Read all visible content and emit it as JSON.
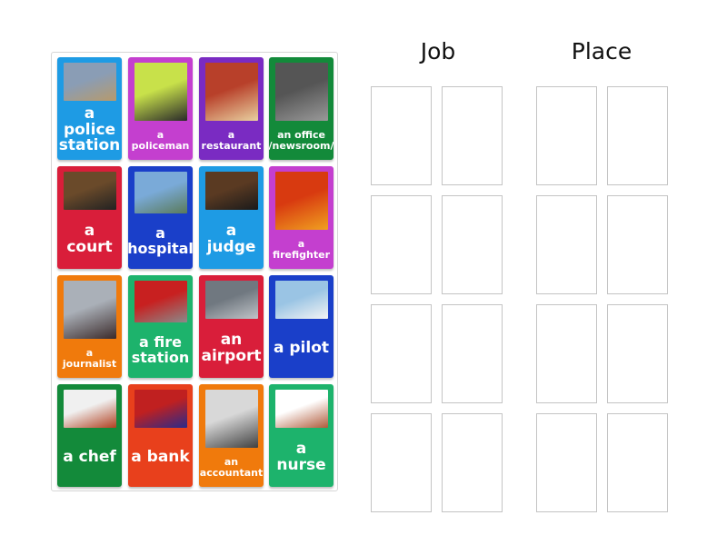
{
  "activity": "group-sort",
  "groups": [
    {
      "title": "Job",
      "slots": 8
    },
    {
      "title": "Place",
      "slots": 8
    }
  ],
  "cards": [
    {
      "label": "a police station",
      "color": "#1e9be4",
      "image": "police-station-photo",
      "size": "big",
      "pic": [
        "#8a9db5",
        "#b69a6c"
      ]
    },
    {
      "label": "a policeman",
      "color": "#c43fcf",
      "image": "policeman-photo",
      "size": "small",
      "pic": [
        "#c8e14a",
        "#2a2a2a"
      ]
    },
    {
      "label": "a restaurant",
      "color": "#7a2bc2",
      "image": "restaurant-photo",
      "size": "small",
      "pic": [
        "#b8402a",
        "#e8d0a0"
      ]
    },
    {
      "label": "an office /newsroom/",
      "color": "#138a3a",
      "image": "office-newsroom-photo",
      "size": "small",
      "pic": [
        "#555555",
        "#999999"
      ]
    },
    {
      "label": "a court",
      "color": "#d91e3a",
      "image": "court-photo",
      "size": "big",
      "pic": [
        "#6a4a2a",
        "#222222"
      ]
    },
    {
      "label": "a hospital",
      "color": "#1a3fc9",
      "image": "hospital-photo",
      "size": "mid",
      "pic": [
        "#7aaad8",
        "#5a7a5a"
      ]
    },
    {
      "label": "a judge",
      "color": "#1e9be4",
      "image": "judge-photo",
      "size": "big",
      "pic": [
        "#5a3a22",
        "#1a1a1a"
      ]
    },
    {
      "label": "a firefighter",
      "color": "#c43fcf",
      "image": "firefighter-photo",
      "size": "small",
      "pic": [
        "#d83a10",
        "#f0a020"
      ]
    },
    {
      "label": "a journalist",
      "color": "#f07a0c",
      "image": "journalist-photo",
      "size": "small",
      "pic": [
        "#aab0b8",
        "#3a2a2a"
      ]
    },
    {
      "label": "a fire station",
      "color": "#1db36c",
      "image": "fire-station-photo",
      "size": "mid",
      "pic": [
        "#c82020",
        "#8a8a8a"
      ]
    },
    {
      "label": "an airport",
      "color": "#d91e3a",
      "image": "airport-photo",
      "size": "big",
      "pic": [
        "#707880",
        "#c0c4c8"
      ]
    },
    {
      "label": "a pilot",
      "color": "#1a3fc9",
      "image": "pilot-photo",
      "size": "big",
      "pic": [
        "#9ac4e4",
        "#f4f4f4"
      ]
    },
    {
      "label": "a chef",
      "color": "#138a3a",
      "image": "chef-photo",
      "size": "big",
      "pic": [
        "#f0f0f0",
        "#b04020"
      ]
    },
    {
      "label": "a bank",
      "color": "#e8401c",
      "image": "bank-photo",
      "size": "big",
      "pic": [
        "#c02020",
        "#2a2a8a"
      ]
    },
    {
      "label": "an accountant",
      "color": "#f07a0c",
      "image": "accountant-photo",
      "size": "small",
      "pic": [
        "#d8d8d8",
        "#404040"
      ]
    },
    {
      "label": "a nurse",
      "color": "#1db36c",
      "image": "nurse-photo",
      "size": "big",
      "pic": [
        "#ffffff",
        "#b05a3a"
      ]
    }
  ]
}
